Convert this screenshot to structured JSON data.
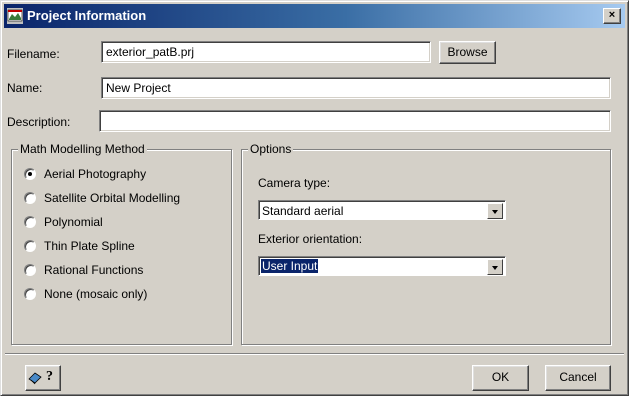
{
  "window": {
    "title": "Project Information",
    "close_label": "×"
  },
  "filename": {
    "label": "Filename:",
    "value": "exterior_patB.prj",
    "browse_label": "Browse"
  },
  "name": {
    "label": "Name:",
    "value": "New Project"
  },
  "description": {
    "label": "Description:",
    "value": ""
  },
  "math_method": {
    "title": "Math Modelling Method",
    "options": [
      "Aerial Photography",
      "Satellite Orbital Modelling",
      "Polynomial",
      "Thin Plate Spline",
      "Rational Functions",
      "None (mosaic only)"
    ],
    "selected": "Aerial Photography"
  },
  "options": {
    "title": "Options",
    "camera_type_label": "Camera type:",
    "camera_type_value": "Standard aerial",
    "exterior_label": "Exterior orientation:",
    "exterior_value": "User Input"
  },
  "footer": {
    "help_icon_label": "?",
    "ok_label": "OK",
    "cancel_label": "Cancel"
  },
  "colors": {
    "title_start": "#0a246a",
    "title_end": "#a6caf0",
    "dialog_bg": "#d4d0c8",
    "highlight": "#0a246a"
  }
}
